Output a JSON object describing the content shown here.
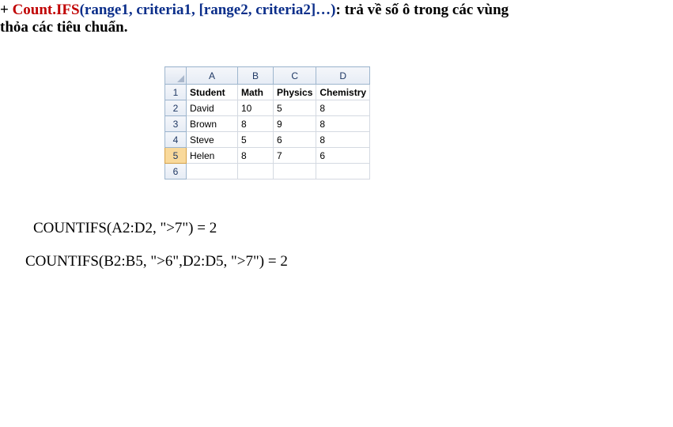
{
  "heading": {
    "plus": "+ ",
    "functionName": "Count.IFS",
    "params": "(range1, criteria1, [range2, criteria2]…)",
    "separator": ": ",
    "description": "trả về số ô trong các vùng",
    "line2": "thỏa các tiêu chuẩn."
  },
  "spreadsheet": {
    "columns": [
      "A",
      "B",
      "C",
      "D"
    ],
    "rowNumbers": [
      "1",
      "2",
      "3",
      "4",
      "5",
      "6"
    ],
    "headers": {
      "a": "Student",
      "b": "Math",
      "c": "Physics",
      "d": "Chemistry"
    },
    "rows": [
      {
        "a": "David",
        "b": "10",
        "c": "5",
        "d": "8"
      },
      {
        "a": "Brown",
        "b": "8",
        "c": "9",
        "d": "8"
      },
      {
        "a": "Steve",
        "b": "5",
        "c": "6",
        "d": "8"
      },
      {
        "a": "Helen",
        "b": "8",
        "c": "7",
        "d": "6"
      }
    ],
    "selectedRowLabel": "5"
  },
  "examples": {
    "ex1": "COUNTIFS(A2:D2, \">7\") = 2",
    "ex2": "COUNTIFS(B2:B5, \">6\",D2:D5, \">7\") = 2"
  }
}
